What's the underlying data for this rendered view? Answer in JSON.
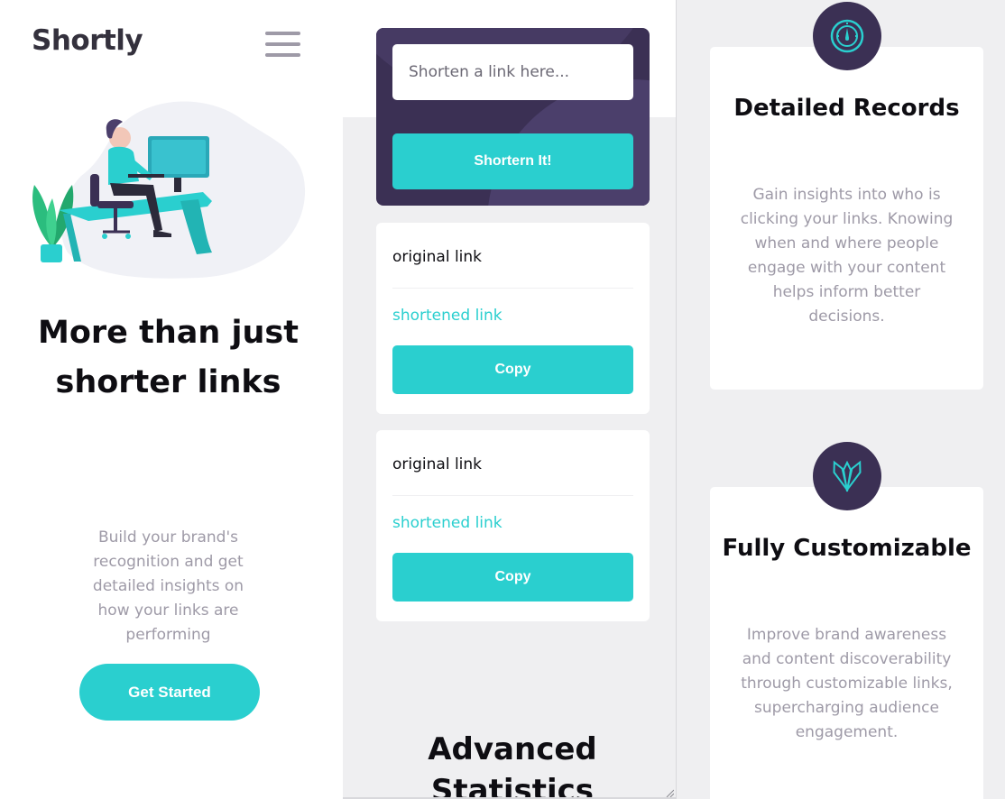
{
  "header": {
    "logo": "Shortly",
    "menu_icon": "hamburger-menu-icon"
  },
  "hero": {
    "illustration": "person-working-illustration",
    "title": "More than just shorter links",
    "subtitle": "Build your brand's recognition and get detailed insights on how your links are performing",
    "cta_label": "Get Started"
  },
  "shortener": {
    "placeholder": "Shorten a link here...",
    "button_label": "Shortern It!"
  },
  "results": [
    {
      "original": "original link",
      "shortened": "shortened link",
      "copy_label": "Copy"
    },
    {
      "original": "original link",
      "shortened": "shortened link",
      "copy_label": "Copy"
    }
  ],
  "statistics": {
    "title": "Advanced Statistics"
  },
  "features": [
    {
      "icon": "speedometer-icon",
      "title": "Detailed Records",
      "text": "Gain insights into who is clicking your links. Knowing when and where people engage with your content helps inform better decisions."
    },
    {
      "icon": "pens-icon",
      "title": "Fully Customizable",
      "text": "Improve brand awareness and content discoverability through customizable links, supercharging audience engagement."
    }
  ],
  "colors": {
    "cyan": "#2acfcf",
    "dark_violet": "#3b3054",
    "gray": "#9e9aa7",
    "very_dark_blue": "#34313d",
    "light_gray_bg": "#efeff1"
  }
}
